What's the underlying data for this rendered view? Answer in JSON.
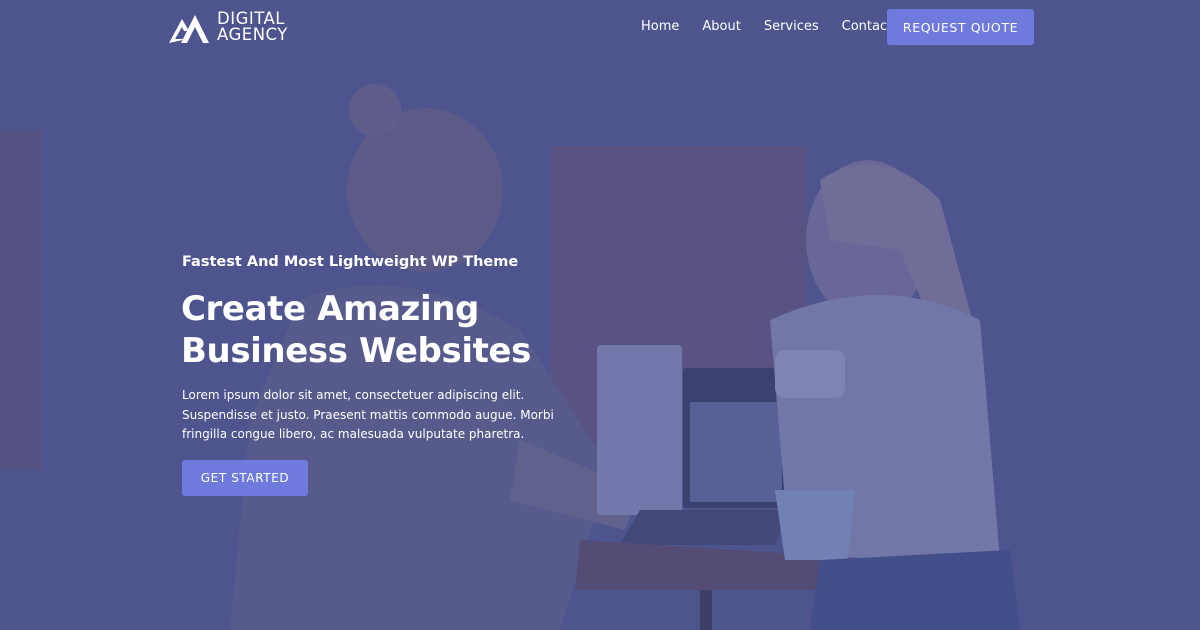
{
  "brand": {
    "line1": "DIGITAL",
    "line2": "AGENCY",
    "logo_icon": "mountain-logo-icon"
  },
  "nav": {
    "items": [
      "Home",
      "About",
      "Services",
      "Contact"
    ],
    "cta_label": "REQUEST QUOTE"
  },
  "hero": {
    "eyebrow": "Fastest And Most Lightweight WP Theme",
    "title_line1": "Create Amazing",
    "title_line2": "Business Websites",
    "description": "Lorem ipsum dolor sit amet, consectetuer adipiscing elit. Suspendisse et justo. Praesent mattis commodo augue. Morbi fringilla congue libero, ac malesuada vulputate pharetra.",
    "cta_label": "GET STARTED",
    "background_image": "two people laughing at a table with laptops and coffee cups"
  },
  "colors": {
    "accent": "#6e7bdc",
    "overlay": "#4b5185",
    "text": "#ffffff"
  }
}
